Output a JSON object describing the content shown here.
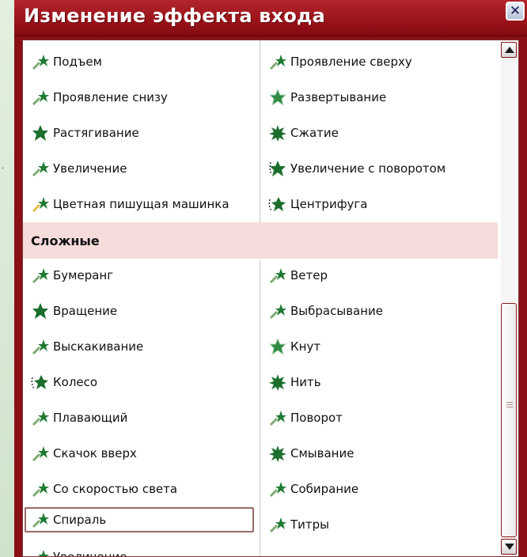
{
  "dialog": {
    "title": "Изменение эффекта входа",
    "close_glyph": "✕"
  },
  "top_items": {
    "left": [
      "Подъем",
      "Проявление снизу",
      "Растягивание",
      "Увеличение",
      "Цветная пишущая машинка"
    ],
    "right": [
      "Проявление сверху",
      "Развертывание",
      "Сжатие",
      "Увеличение с поворотом",
      "Центрифуга"
    ]
  },
  "section": {
    "title": "Сложные"
  },
  "complex_items": {
    "left": [
      "Бумеранг",
      "Вращение",
      "Выскакивание",
      "Колесо",
      "Плавающий",
      "Скачок вверх",
      "Со скоростью света",
      "Спираль",
      "Увеличение"
    ],
    "right": [
      "Ветер",
      "Выбрасывание",
      "Кнут",
      "Нить",
      "Поворот",
      "Смывание",
      "Собирание",
      "Титры"
    ]
  },
  "selected_item": "Спираль",
  "colors": {
    "title_bar": "#9c141b",
    "section_bg": "#f7dcdc",
    "star_green": "#1f7a33"
  },
  "icons": {
    "effect_icon": "star-trail-icon"
  }
}
